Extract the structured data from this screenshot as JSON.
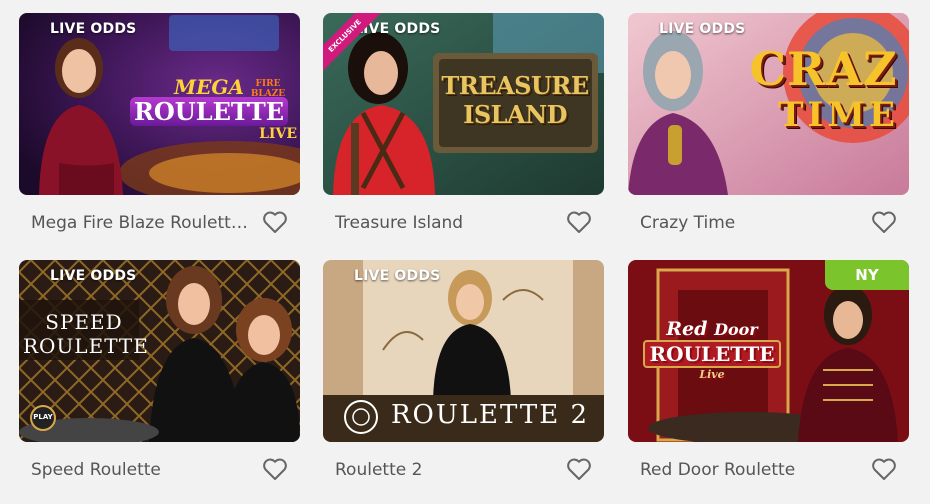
{
  "cards": [
    {
      "title": "Mega Fire Blaze Roulette Live",
      "badge": "LIVE ODDS",
      "logo": {
        "line1": "MEGA",
        "line2": "FIRE BLAZE",
        "line3": "ROULETTE",
        "line4": "LIVE"
      },
      "favorite_icon": "heart-outline-icon"
    },
    {
      "title": "Treasure Island",
      "badge": "LIVE ODDS",
      "ribbon": "EXCLUSIVE",
      "logo": {
        "line1": "TREASURE",
        "line2": "ISLAND"
      },
      "favorite_icon": "heart-outline-icon"
    },
    {
      "title": "Crazy Time",
      "badge": "LIVE ODDS",
      "logo": {
        "line1": "CRAZ",
        "line2": "TIME"
      },
      "favorite_icon": "heart-outline-icon"
    },
    {
      "title": "Speed Roulette",
      "badge": "LIVE ODDS",
      "logo": {
        "line1": "SPEED",
        "line2": "ROULETTE"
      },
      "play_label": "PLAY",
      "favorite_icon": "heart-outline-icon"
    },
    {
      "title": "Roulette 2",
      "badge": "LIVE ODDS",
      "logo": {
        "line1": "ROULETTE 2"
      },
      "favorite_icon": "heart-outline-icon"
    },
    {
      "title": "Red Door Roulette",
      "tag": "NY",
      "logo": {
        "line1": "Red",
        "line2": "Door",
        "line3": "ROULETTE",
        "line4": "Live"
      },
      "favorite_icon": "heart-outline-icon"
    }
  ],
  "colors": {
    "background": "#f2f2f2",
    "title_text": "#555555",
    "ny_badge": "#7bc42c",
    "exclusive_ribbon": "#d01b7d"
  }
}
